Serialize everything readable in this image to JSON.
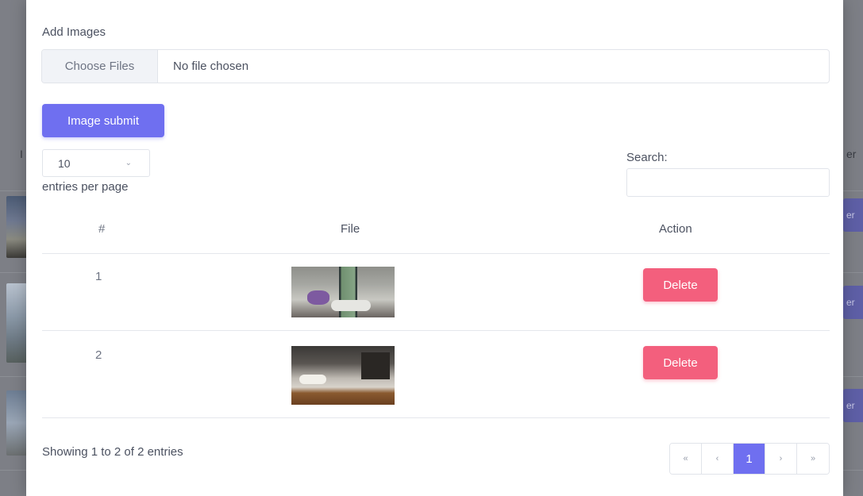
{
  "background": {
    "header_left": "I",
    "header_right": "er",
    "row_button_label": "er"
  },
  "modal": {
    "add_images_label": "Add Images",
    "file_input": {
      "button_label": "Choose Files",
      "status": "No file chosen"
    },
    "submit_label": "Image submit",
    "per_page": {
      "value": "10",
      "label": "entries per page"
    },
    "search": {
      "label": "Search:",
      "value": ""
    },
    "table": {
      "headers": [
        "#",
        "File",
        "Action"
      ],
      "rows": [
        {
          "num": "1",
          "image": "bathroom-photo",
          "action": "Delete"
        },
        {
          "num": "2",
          "image": "kitchen-photo",
          "action": "Delete"
        }
      ]
    },
    "summary": "Showing 1 to 2 of 2 entries",
    "pagination": {
      "first": "«",
      "prev": "‹",
      "current": "1",
      "next": "›",
      "last": "»"
    },
    "colors": {
      "primary": "#6f6ff0",
      "danger": "#f35f7d"
    }
  }
}
